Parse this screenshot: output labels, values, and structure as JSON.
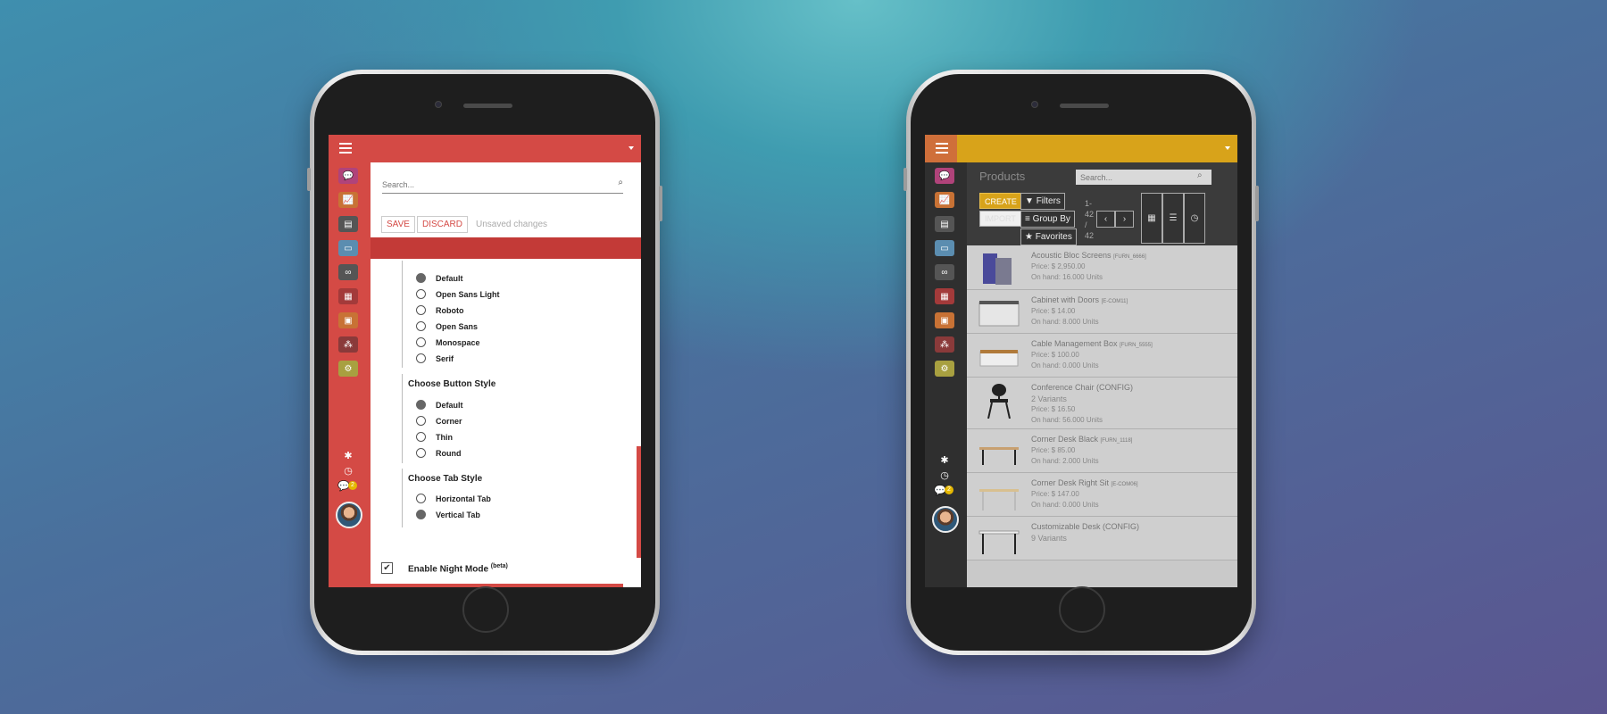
{
  "left_phone": {
    "search": {
      "placeholder": "Search..."
    },
    "actions": {
      "save": "SAVE",
      "discard": "DISCARD",
      "status": "Unsaved changes"
    },
    "fonts": [
      {
        "label": "Default",
        "selected": true
      },
      {
        "label": "Open Sans Light",
        "selected": false
      },
      {
        "label": "Roboto",
        "selected": false
      },
      {
        "label": "Open Sans",
        "selected": false
      },
      {
        "label": "Monospace",
        "selected": false
      },
      {
        "label": "Serif",
        "selected": false
      }
    ],
    "button_style": {
      "title": "Choose Button Style",
      "options": [
        {
          "label": "Default",
          "selected": true
        },
        {
          "label": "Corner",
          "selected": false
        },
        {
          "label": "Thin",
          "selected": false
        },
        {
          "label": "Round",
          "selected": false
        }
      ]
    },
    "tab_style": {
      "title": "Choose Tab Style",
      "options": [
        {
          "label": "Horizontal Tab",
          "selected": false
        },
        {
          "label": "Vertical Tab",
          "selected": true
        }
      ]
    },
    "night_mode": {
      "label": "Enable Night Mode",
      "sup": "(beta)",
      "checked": true
    },
    "chat_badge": "2",
    "colors": {
      "accent": "#d44a45",
      "accent_dark": "#c33a37"
    }
  },
  "right_phone": {
    "title": "Products",
    "search": {
      "placeholder": "Search..."
    },
    "buttons": {
      "create": "CREATE",
      "import": "IMPORT",
      "filters": "Filters",
      "group_by": "Group By",
      "favorites": "Favorites"
    },
    "pager": {
      "line1": "1-",
      "line2": "42",
      "line3": "/",
      "line4": "42"
    },
    "chat_badge": "2",
    "products": [
      {
        "name": "Acoustic Bloc Screens",
        "ref": "[FURN_6666]",
        "lines": [
          "Price: $ 2,950.00",
          "On hand: 16.000 Units"
        ]
      },
      {
        "name": "Cabinet with Doors",
        "ref": "[E-COM11]",
        "lines": [
          "Price: $ 14.00",
          "On hand: 8.000 Units"
        ]
      },
      {
        "name": "Cable Management Box",
        "ref": "[FURN_5555]",
        "lines": [
          "Price: $ 100.00",
          "On hand: 0.000 Units"
        ]
      },
      {
        "name": "Conference Chair (CONFIG)",
        "ref": "",
        "lines": [
          "2 Variants",
          "Price: $ 16.50",
          "On hand: 56.000 Units"
        ]
      },
      {
        "name": "Corner Desk Black",
        "ref": "[FURN_1118]",
        "lines": [
          "Price: $ 85.00",
          "On hand: 2.000 Units"
        ]
      },
      {
        "name": "Corner Desk Right Sit",
        "ref": "[E-COM06]",
        "lines": [
          "Price: $ 147.00",
          "On hand: 0.000 Units"
        ]
      },
      {
        "name": "Customizable Desk (CONFIG)",
        "ref": "",
        "lines": [
          "9 Variants"
        ]
      }
    ],
    "colors": {
      "accent": "#d8a31a",
      "hamburger_box": "#cf6f3a"
    }
  }
}
